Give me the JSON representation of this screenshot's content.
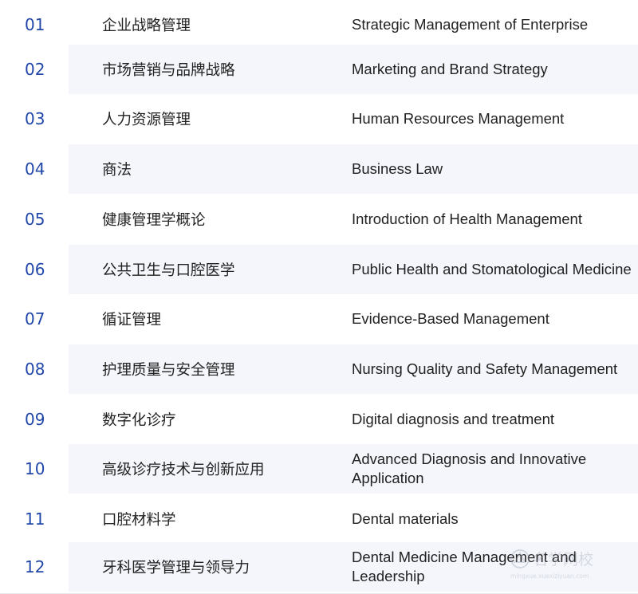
{
  "courses": [
    {
      "num": "01",
      "zh": "企业战略管理",
      "en": "Strategic Management of Enterprise"
    },
    {
      "num": "02",
      "zh": "市场营销与品牌战略",
      "en": "Marketing and Brand Strategy"
    },
    {
      "num": "03",
      "zh": "人力资源管理",
      "en": "Human Resources Management"
    },
    {
      "num": "04",
      "zh": "商法",
      "en": "Business Law"
    },
    {
      "num": "05",
      "zh": "健康管理学概论",
      "en": "Introduction of Health Management"
    },
    {
      "num": "06",
      "zh": "公共卫生与口腔医学",
      "en": "Public Health and Stomatological Medicine"
    },
    {
      "num": "07",
      "zh": "循证管理",
      "en": "Evidence-Based Management"
    },
    {
      "num": "08",
      "zh": "护理质量与安全管理",
      "en": "Nursing Quality and Safety Management"
    },
    {
      "num": "09",
      "zh": "数字化诊疗",
      "en": "Digital diagnosis and treatment"
    },
    {
      "num": "10",
      "zh": "高级诊疗技术与创新应用",
      "en": "Advanced Diagnosis and Innovative Application"
    },
    {
      "num": "11",
      "zh": "口腔材料学",
      "en": "Dental materials"
    },
    {
      "num": "12",
      "zh": "牙科医学管理与领导力",
      "en": "Dental Medicine Management and Leadership"
    }
  ],
  "watermark": {
    "text": "名学网校",
    "url": "mingxue.xuexiziyuan.com"
  }
}
